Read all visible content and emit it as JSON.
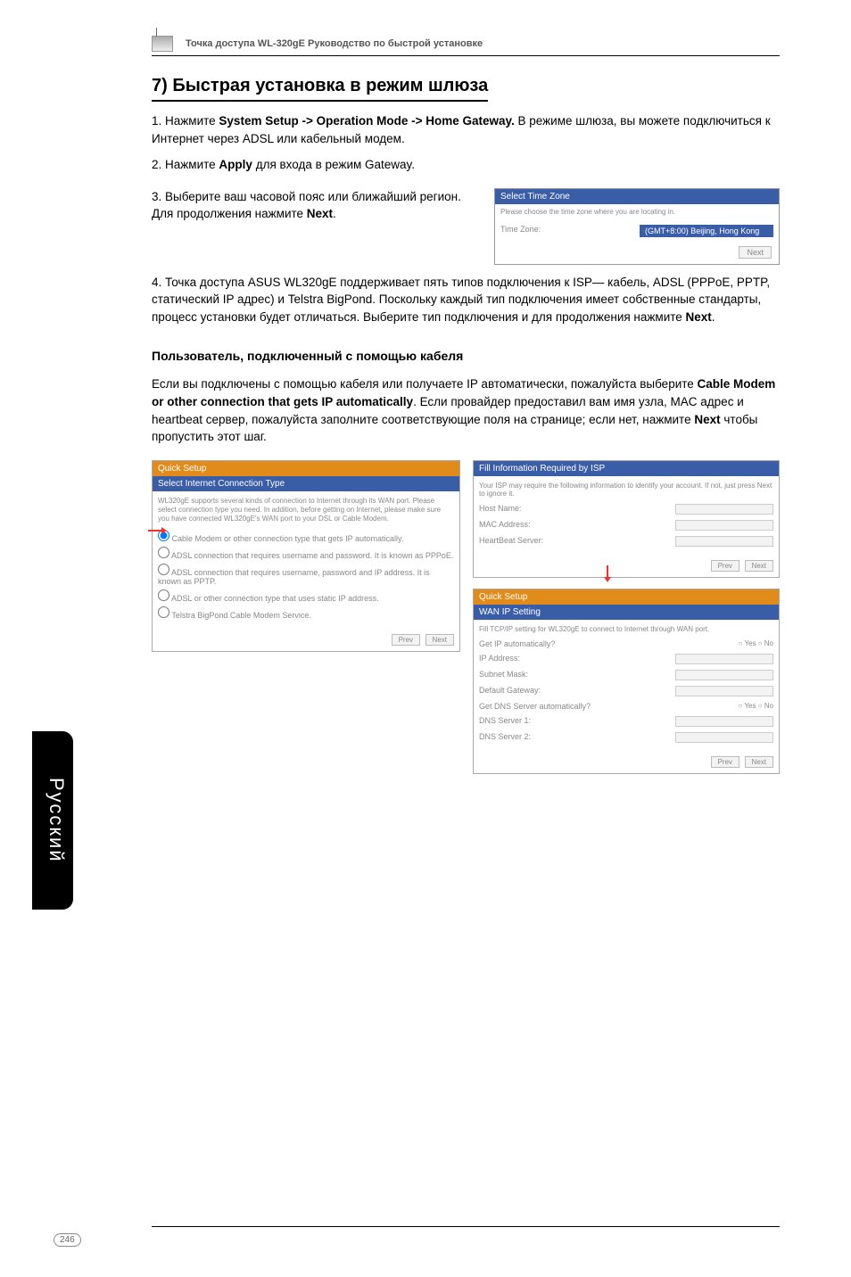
{
  "breadcrumb": "Точка доступа WL-320gE Руководство по быстрой установке",
  "section_title": "7) Быстрая установка в режим шлюза",
  "p1_a": "1. Нажмите ",
  "p1_b": "System Setup -> Operation Mode -> Home Gateway.",
  "p1_c": " В режиме шлюза, вы можете подключиться  к Интернет через ADSL или кабельный модем.",
  "p2_a": "2. Нажмите ",
  "p2_b": "Apply",
  "p2_c": " для входа в режим Gateway.",
  "p3_a": "3. Выберите ваш часовой пояс или ближайший регион. Для продолжения нажмите ",
  "p3_b": "Next",
  "p3_c": ".",
  "tz_panel": {
    "title": "Select Time Zone",
    "desc": "Please choose the time zone where you are locating in.",
    "label": "Time Zone:",
    "value": "(GMT+8:00) Beijing, Hong Kong",
    "btn": "Next"
  },
  "p4": "4. Точка доступа ASUS WL320gE поддерживает пять типов подключения к ISP— кабель, ADSL (PPPoE, PPTP, статический IP адрес) и Telstra BigPond. Поскольку каждый тип подключения имеет собственные стандарты, процесс установки будет отличаться. Выберите тип подключения и для продолжения нажмите ",
  "p4_b": "Next",
  "p4_c": ".",
  "sub_heading": "Пользователь, подключенный с помощью кабеля",
  "p5_a": "Если вы подключены с помощью кабеля или получаете IP автоматически, пожалуйста выберите ",
  "p5_b": "Cable Modem or other connection that gets IP automatically",
  "p5_c": ". Если провайдер предоставил вам имя узла, MAC адрес и heartbeat сервер, пожалуйста заполните соответствующие поля на странице; если нет, нажмите ",
  "p5_d": "Next",
  "p5_e": " чтобы пропустить этот шаг.",
  "left_panel": {
    "hdr1": "Quick Setup",
    "hdr2": "Select Internet Connection Type",
    "desc": "WL320gE supports several kinds of connection to Internet through its WAN port. Please select connection type you need. In addition, before getting on Internet, please make sure you have connected WL320gE's WAN port to your DSL or Cable Modem.",
    "opts": [
      "Cable Modem or other connection type that gets IP automatically.",
      "ADSL connection that requires username and password. It is known as PPPoE.",
      "ADSL connection that requires username, password and IP address. It is known as PPTP.",
      "ADSL or other connection type that uses static IP address.",
      "Telstra BigPond Cable Modem Service."
    ],
    "prev": "Prev",
    "next": "Next"
  },
  "right_top": {
    "hdr": "Fill Information Required by ISP",
    "desc": "Your ISP may require the following information to identify your account. If not, just press Next to ignore it.",
    "fields": [
      "Host Name:",
      "MAC Address:",
      "HeartBeat Server:"
    ],
    "prev": "Prev",
    "next": "Next"
  },
  "right_bot": {
    "hdr1": "Quick Setup",
    "hdr2": "WAN IP Setting",
    "desc": "Fill TCP/IP setting for WL320gE to connect to Internet through WAN port.",
    "rows": [
      {
        "label": "Get IP automatically?",
        "type": "opt",
        "yes": "Yes",
        "no": "No"
      },
      {
        "label": "IP Address:",
        "type": "fld"
      },
      {
        "label": "Subnet Mask:",
        "type": "fld"
      },
      {
        "label": "Default Gateway:",
        "type": "fld"
      },
      {
        "label": "Get DNS Server automatically?",
        "type": "opt",
        "yes": "Yes",
        "no": "No"
      },
      {
        "label": "DNS Server 1:",
        "type": "fld"
      },
      {
        "label": "DNS Server 2:",
        "type": "fld"
      }
    ],
    "prev": "Prev",
    "next": "Next"
  },
  "side_tab": "Русский",
  "page_num": "246"
}
